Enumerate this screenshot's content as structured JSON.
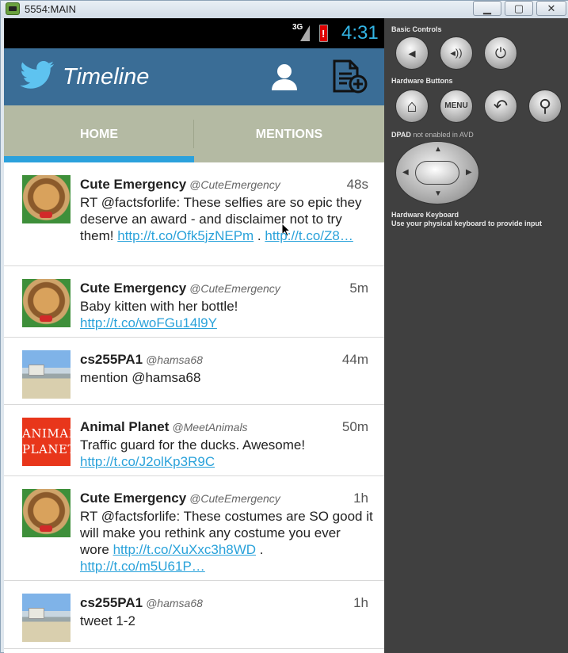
{
  "window": {
    "title": "5554:MAIN",
    "min_glyph": "▁",
    "max_glyph": "▢",
    "close_glyph": "✕"
  },
  "status_bar": {
    "network": "3G",
    "time": "4:31"
  },
  "action_bar": {
    "title": "Timeline"
  },
  "tabs": [
    {
      "label": "HOME",
      "selected": true
    },
    {
      "label": "MENTIONS",
      "selected": false
    }
  ],
  "tweets": [
    {
      "name": "Cute Emergency",
      "handle": "@CuteEmergency",
      "time": "48s",
      "avatar": "dog",
      "text": "RT @factsforlife: These selfies are so epic they deserve an award - and disclaimer not to try them! ",
      "link1": "http://t.co/Ofk5jzNEPm",
      "sep": " . ",
      "link2": "http://t.co/Z8…"
    },
    {
      "name": "Cute Emergency",
      "handle": "@CuteEmergency",
      "time": "5m",
      "avatar": "dog",
      "text": "Baby kitten with her bottle! ",
      "link1": "http://t.co/woFGu14l9Y"
    },
    {
      "name": "cs255PA1",
      "handle": "@hamsa68",
      "time": "44m",
      "avatar": "beach",
      "text": "mention @hamsa68"
    },
    {
      "name": "Animal Planet",
      "handle": "@MeetAnimals",
      "time": "50m",
      "avatar": "animal-planet",
      "avatar_text_line1": "ANIMAL",
      "avatar_text_line2": "PLANET",
      "text": "Traffic guard for the ducks. Awesome! ",
      "link1": "http://t.co/J2olKp3R9C"
    },
    {
      "name": "Cute Emergency",
      "handle": "@CuteEmergency",
      "time": "1h",
      "avatar": "dog",
      "text": "RT @factsforlife: These costumes are SO good it will make you rethink any costume you ever wore ",
      "link1": "http://t.co/XuXxc3h8WD",
      "sep": " . ",
      "link2": "http://t.co/m5U61P…"
    },
    {
      "name": "cs255PA1",
      "handle": "@hamsa68",
      "time": "1h",
      "avatar": "beach",
      "text": "tweet 1-2"
    }
  ],
  "emulator_panel": {
    "basic_controls_label": "Basic Controls",
    "hardware_buttons_label": "Hardware Buttons",
    "menu_button_label": "MENU",
    "dpad_label": "DPAD",
    "dpad_note": "not enabled in AVD",
    "keyboard_label": "Hardware Keyboard",
    "keyboard_note": "Use your physical keyboard to provide input",
    "volume_down_glyph": "◂",
    "volume_up_glyph": "◂))",
    "power_glyph": "⏻",
    "home_glyph": "⌂",
    "back_glyph": "↶",
    "search_glyph": "⚲"
  },
  "colors": {
    "action_bar": "#3a6d96",
    "tab_bar": "#b4baa3",
    "tab_indicator": "#2ba1dc",
    "link": "#2aa2da",
    "clock": "#33b5e5"
  }
}
